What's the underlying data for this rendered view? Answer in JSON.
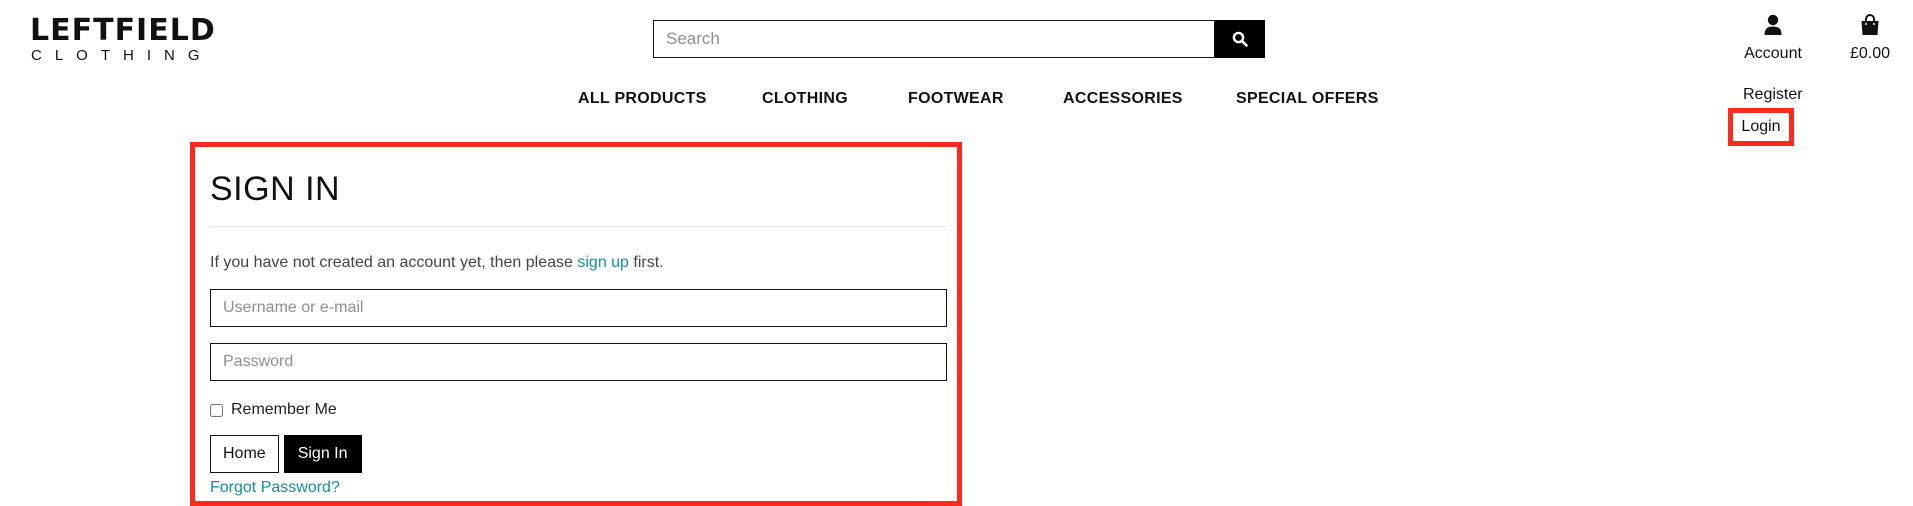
{
  "logo": {
    "main": "LEFTFIELD",
    "sub": "CLOTHING"
  },
  "search": {
    "placeholder": "Search",
    "icon": "search-icon"
  },
  "account": {
    "label": "Account",
    "icon": "user-icon"
  },
  "cart": {
    "total": "£0.00",
    "icon": "shopping-bag-icon"
  },
  "nav": [
    {
      "label": "ALL PRODUCTS"
    },
    {
      "label": "CLOTHING"
    },
    {
      "label": "FOOTWEAR"
    },
    {
      "label": "ACCESSORIES"
    },
    {
      "label": "SPECIAL OFFERS"
    }
  ],
  "account_menu": {
    "register": "Register",
    "login": "Login"
  },
  "signin": {
    "title": "SIGN IN",
    "intro_before": "If you have not created an account yet, then please ",
    "intro_link": "sign up",
    "intro_after": " first.",
    "username_placeholder": "Username or e-mail",
    "password_placeholder": "Password",
    "remember_label": "Remember Me",
    "remember_checked": false,
    "home_button": "Home",
    "signin_button": "Sign In",
    "forgot_link": "Forgot Password?"
  },
  "colors": {
    "highlight": "#ff2a1f",
    "link": "#148fa3",
    "primary": "#000000"
  }
}
